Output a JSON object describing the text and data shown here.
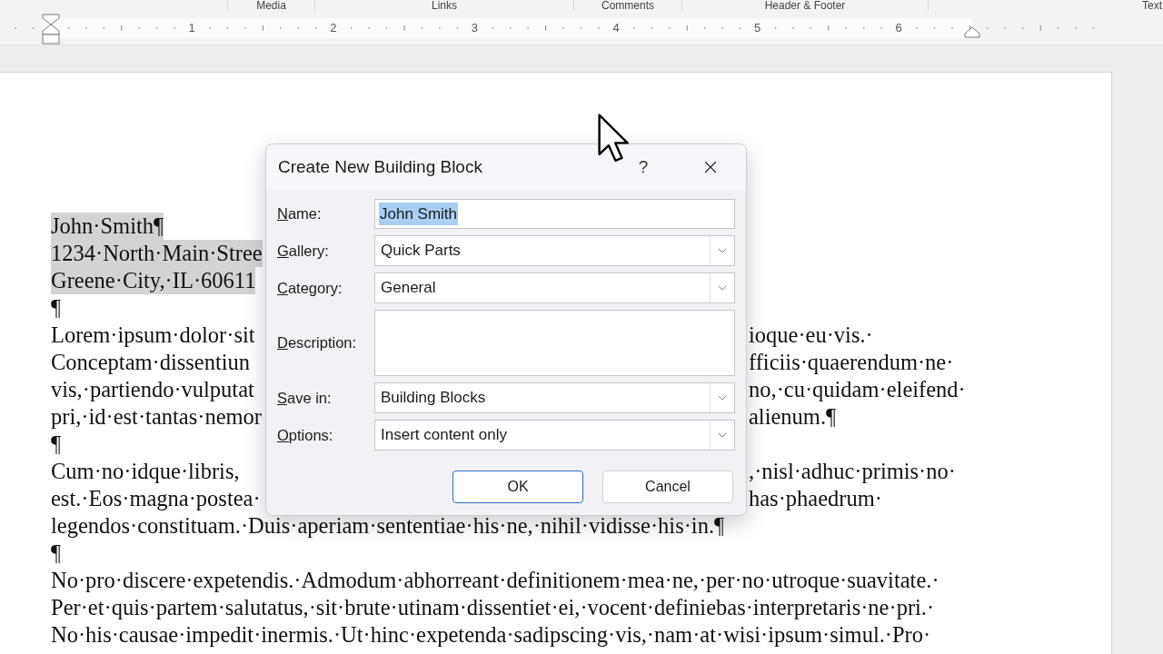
{
  "ribbon_groups": [
    {
      "label": "Media"
    },
    {
      "label": "Links"
    },
    {
      "label": "Comments"
    },
    {
      "label": "Header & Footer"
    },
    {
      "label": "Text"
    }
  ],
  "ruler": {
    "labels": [
      "1",
      "2",
      "3",
      "4",
      "5",
      "6"
    ]
  },
  "document": {
    "lines": [
      {
        "left": "John·Smith¶",
        "selected": true
      },
      {
        "left": "1234·North·Main·Stree",
        "selected": true
      },
      {
        "left": "Greene·City,·IL·60611",
        "selected": true
      },
      {
        "left": "¶",
        "selected": false
      },
      {
        "left": "Lorem·ipsum·dolor·sit",
        "right": "ioque·eu·vis.·",
        "selected": false
      },
      {
        "left": "Conceptam·dissentiun",
        "right": "fficiis·quaerendum·ne·",
        "selected": false
      },
      {
        "left": "vis,·partiendo·vulputat",
        "right": "no,·cu·quidam·eleifend·",
        "selected": false
      },
      {
        "left": "pri,·id·est·tantas·nemor",
        "right": "alienum.¶",
        "selected": false
      },
      {
        "left": "¶",
        "selected": false
      },
      {
        "left": "Cum·no·idque·libris,",
        "right": ",·nisl·adhuc·primis·no·",
        "selected": false
      },
      {
        "left": "est.·Eos·magna·postea·",
        "right": "has·phaedrum·",
        "selected": false
      },
      {
        "left": "legendos·constituam.·Duis·aperiam·sententiae·his·ne,·nihil·vidisse·his·in.¶",
        "selected": false
      },
      {
        "left": "¶",
        "selected": false
      },
      {
        "left": "No·pro·discere·expetendis.·Admodum·abhorreant·definitionem·mea·ne,·per·no·utroque·suavitate.·",
        "selected": false
      },
      {
        "left": "Per·et·quis·partem·salutatus,·sit·brute·utinam·dissentiet·ei,·vocent·definiebas·interpretaris·ne·pri.·",
        "selected": false
      },
      {
        "left": "No·his·causae·impedit·inermis.·Ut·hinc·expetenda·sadipscing·vis,·nam·at·wisi·ipsum·simul.·Pro·",
        "selected": false
      }
    ]
  },
  "dialog": {
    "title": "Create New Building Block",
    "help": "?",
    "fields": [
      {
        "label": "Name:",
        "kind": "text",
        "value": "John Smith",
        "value_selected": true
      },
      {
        "label": "Gallery:",
        "kind": "select",
        "value": "Quick Parts"
      },
      {
        "label": "Category:",
        "kind": "select",
        "value": "General"
      },
      {
        "label": "Description:",
        "kind": "textarea"
      },
      {
        "label": "Save in:",
        "kind": "select",
        "value": "Building Blocks"
      },
      {
        "label": "Options:",
        "kind": "select",
        "value": "Insert content only"
      }
    ],
    "buttons": [
      {
        "label": "OK",
        "default": true
      },
      {
        "label": "Cancel",
        "default": false
      }
    ]
  }
}
